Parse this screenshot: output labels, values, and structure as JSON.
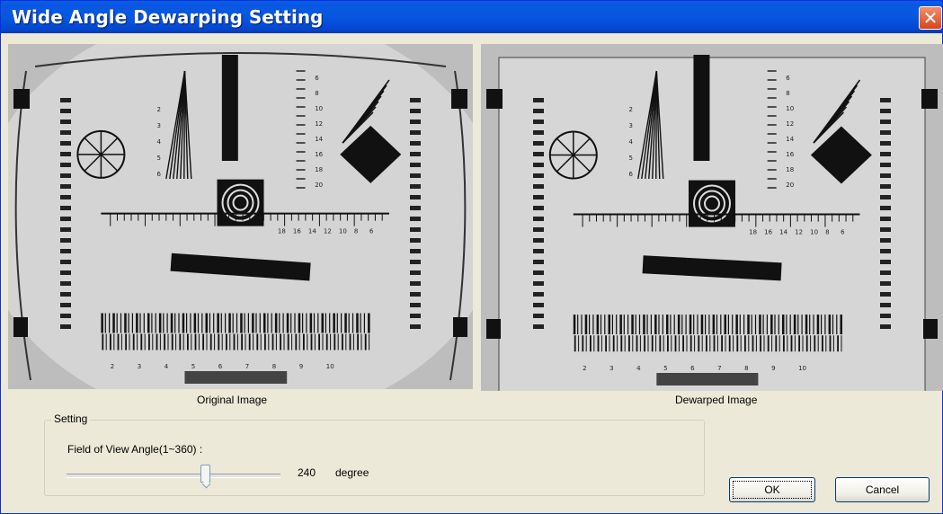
{
  "window": {
    "title": "Wide Angle Dewarping Setting",
    "close_glyph": "✕"
  },
  "images": {
    "original_caption": "Original Image",
    "dewarped_caption": "Dewarped Image",
    "chart_numbers_top": [
      "6",
      "8",
      "10",
      "12",
      "14",
      "16",
      "18",
      "20"
    ],
    "chart_numbers_left": [
      "2",
      "3",
      "4",
      "5",
      "6"
    ],
    "chart_numbers_center": [
      "18",
      "16",
      "14",
      "12",
      "10",
      "8",
      "6"
    ],
    "chart_numbers_bottom": [
      "2",
      "3",
      "4",
      "5",
      "6",
      "7",
      "8",
      "9",
      "10"
    ]
  },
  "setting": {
    "group_label": "Setting",
    "fov_label": "Field of View Angle(1~360) :",
    "fov_value": "240",
    "fov_unit": "degree",
    "fov_range": [
      1,
      360
    ],
    "fov_fraction": 0.664
  },
  "buttons": {
    "ok_label": "OK",
    "cancel_label": "Cancel"
  },
  "icons": {
    "close": "close-icon"
  },
  "colors": {
    "titlebar": "#0757e0",
    "close_button": "#d9441c",
    "dialog_bg": "#ece9d8"
  }
}
